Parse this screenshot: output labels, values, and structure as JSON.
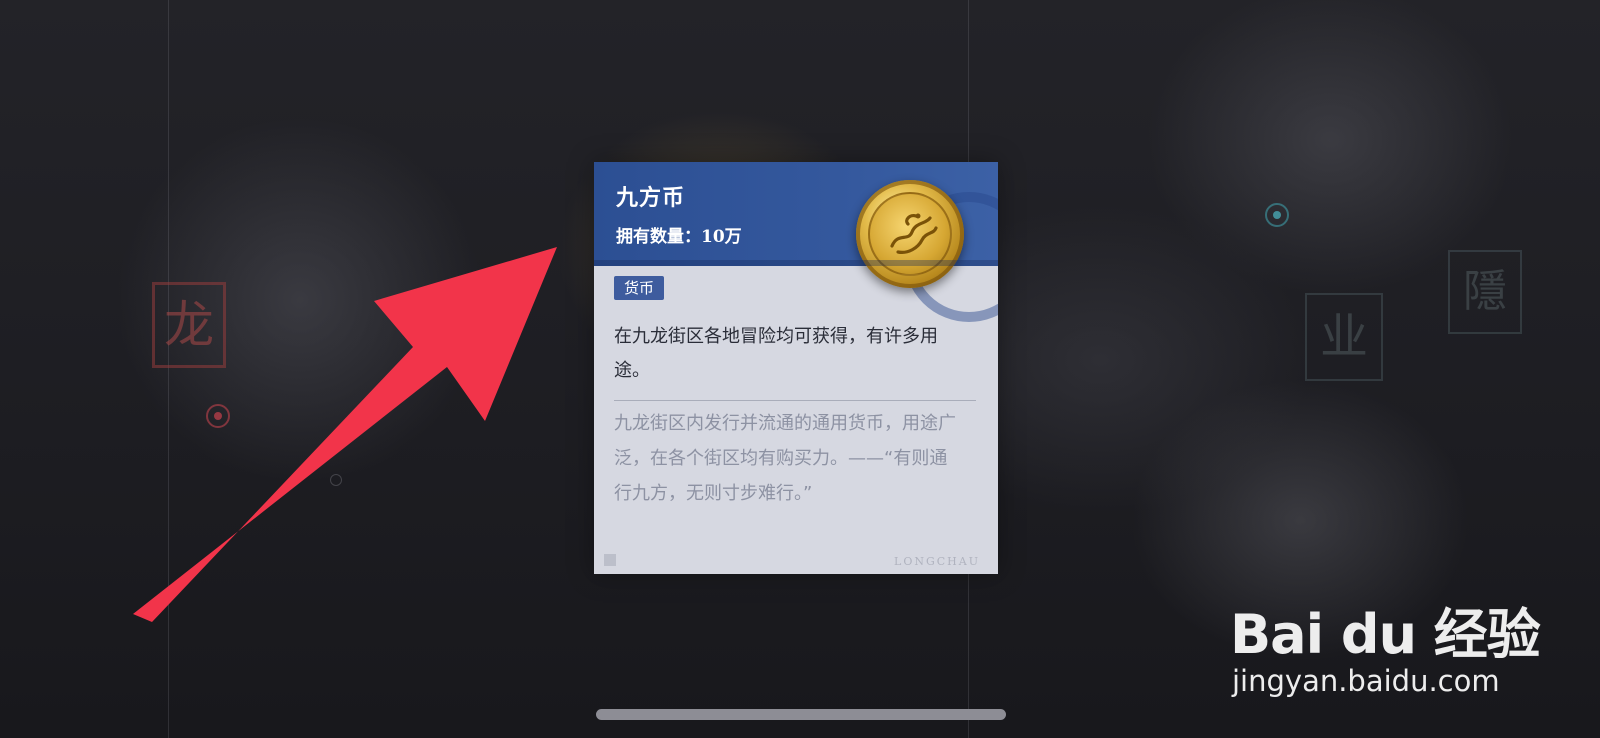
{
  "item": {
    "name": "九方币",
    "owned_label": "拥有数量：",
    "owned_value": "10万",
    "tag": "货币",
    "description": "在九龙街区各地冒险均可获得，有许多用途。",
    "flavor": "九龙街区内发行并流通的通用货币，用途广泛，在各个街区均有购买力。——“有则通行九方，无则寸步难行。”",
    "footer_mark": "LONGCHAU"
  },
  "background": {
    "seal_left": "龙",
    "seal_right_1": "业",
    "seal_right_2": "隱"
  },
  "watermark": {
    "logo": "Bai du 经验",
    "url": "jingyan.baidu.com"
  },
  "colors": {
    "card_header": "#2c4f93",
    "card_body": "#d6d8e1",
    "tag": "#3e5c9e",
    "arrow": "#f2344a",
    "coin": "#d6a733"
  },
  "icons": {
    "coin": "dragon-coin-icon",
    "arrow": "red-pointer-arrow"
  }
}
